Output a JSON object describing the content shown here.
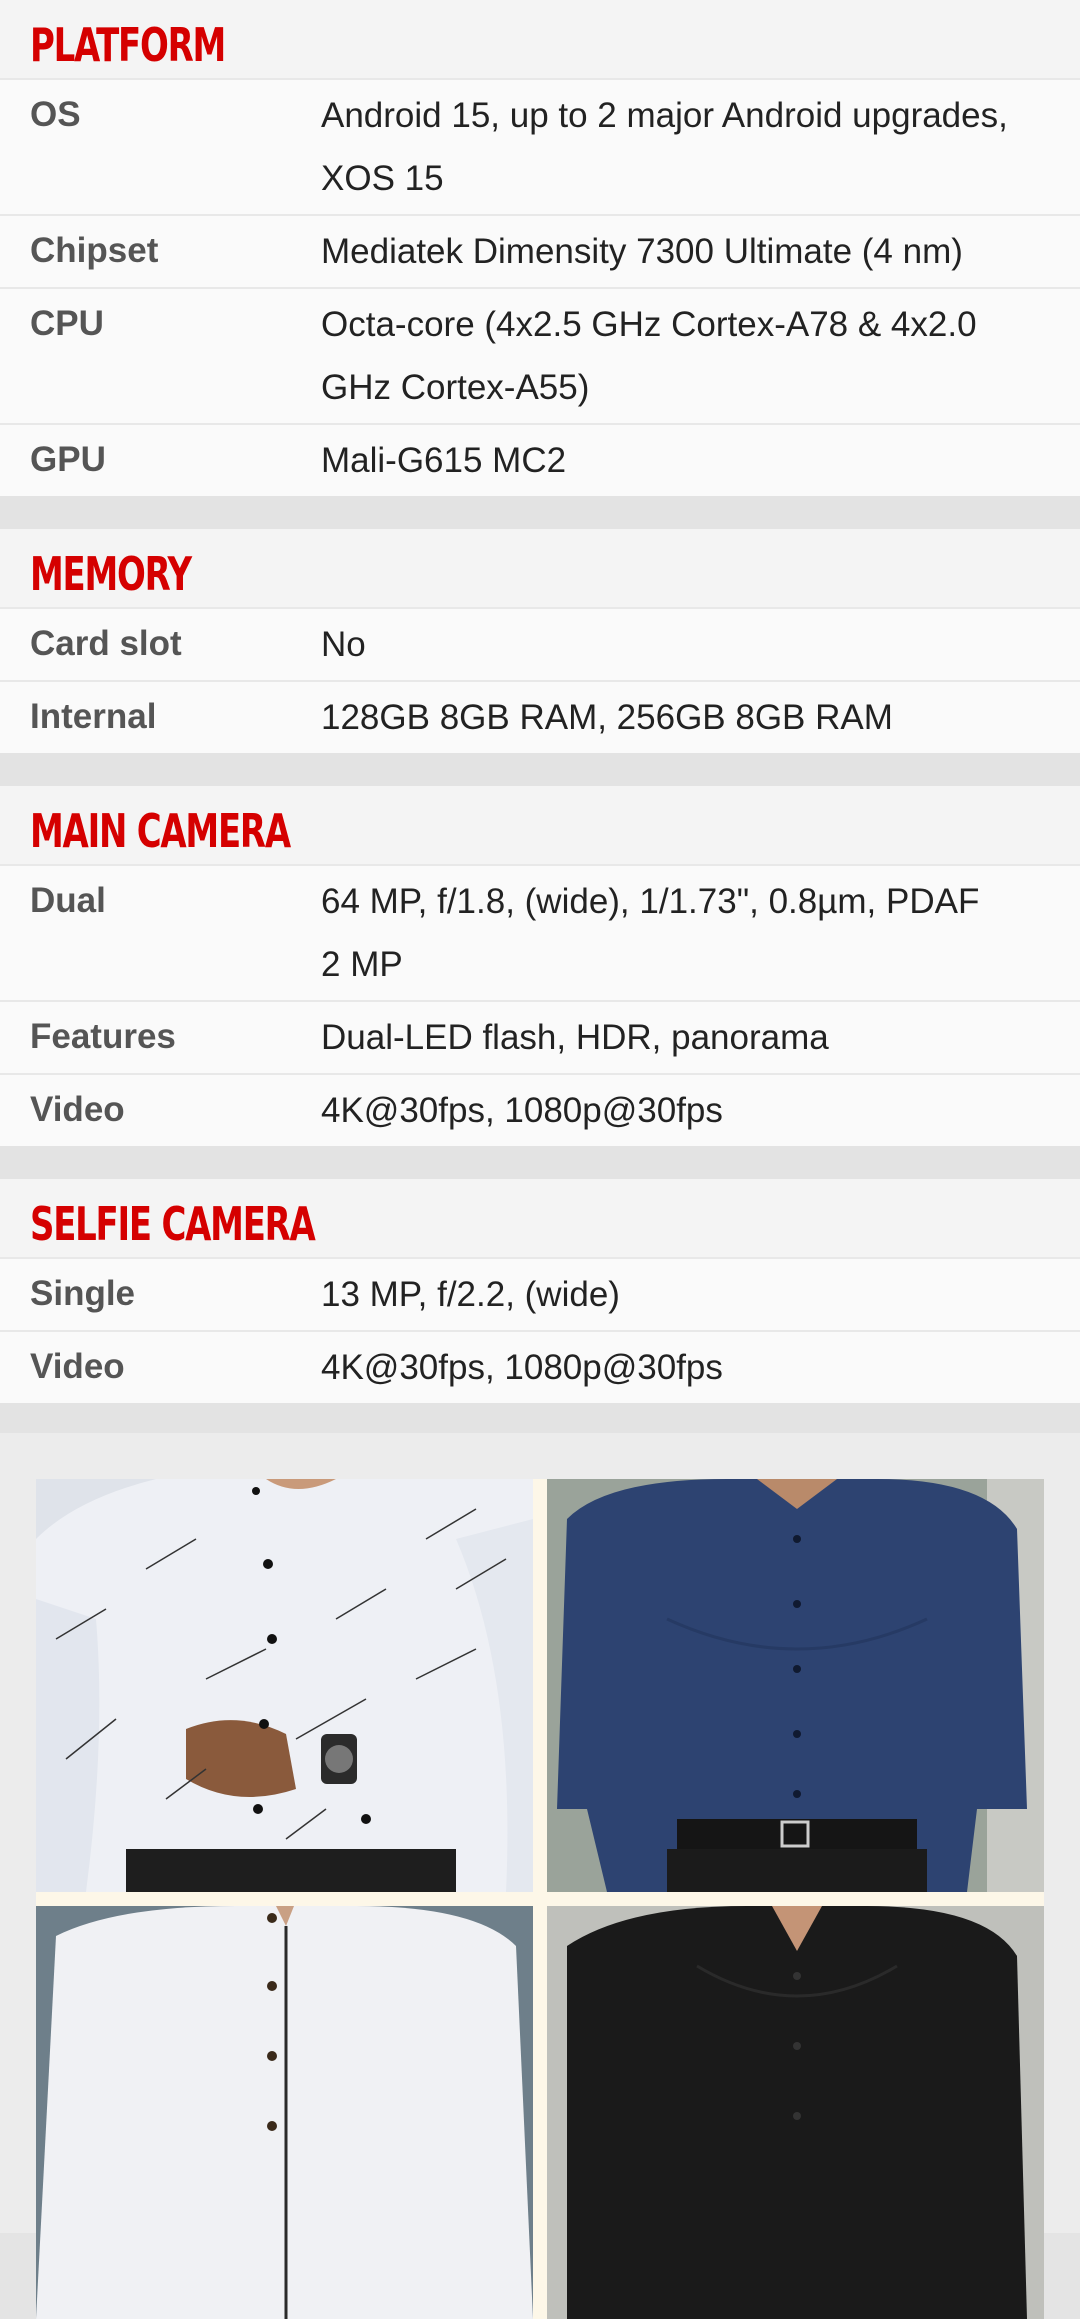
{
  "sections": [
    {
      "title": "PLATFORM",
      "rows": [
        {
          "label": "OS",
          "value": "Android 15, up to 2 major Android upgrades, XOS 15"
        },
        {
          "label": "Chipset",
          "value": "Mediatek Dimensity 7300 Ultimate (4 nm)"
        },
        {
          "label": "CPU",
          "value": "Octa-core (4x2.5 GHz Cortex-A78 & 4x2.0 GHz Cortex-A55)"
        },
        {
          "label": "GPU",
          "value": "Mali-G615 MC2"
        }
      ]
    },
    {
      "title": "MEMORY",
      "rows": [
        {
          "label": "Card slot",
          "value": "No"
        },
        {
          "label": "Internal",
          "value": "128GB 8GB RAM, 256GB 8GB RAM"
        }
      ]
    },
    {
      "title": "MAIN CAMERA",
      "rows": [
        {
          "label": "Dual",
          "value": "64 MP, f/1.8, (wide), 1/1.73\", 0.8µm, PDAF"
        },
        {
          "label": "Features",
          "value": "Dual-LED flash, HDR, panorama"
        },
        {
          "label": "Video",
          "value": "4K@30fps, 1080p@30fps"
        }
      ],
      "dual_extra": "2 MP"
    },
    {
      "title": "SELFIE CAMERA",
      "rows": [
        {
          "label": "Single",
          "value": "13 MP, f/2.2, (wide)"
        },
        {
          "label": "Video",
          "value": "4K@30fps, 1080p@30fps"
        }
      ]
    }
  ],
  "ad": {
    "tiles": [
      {
        "name": "white-patterned-shirt",
        "color": "#f4f5f8"
      },
      {
        "name": "navy-blue-shirt",
        "color": "#2b4170"
      },
      {
        "name": "white-piped-shirt",
        "color": "#f1f2f4"
      },
      {
        "name": "black-shirt",
        "color": "#1a1a1a"
      }
    ]
  }
}
